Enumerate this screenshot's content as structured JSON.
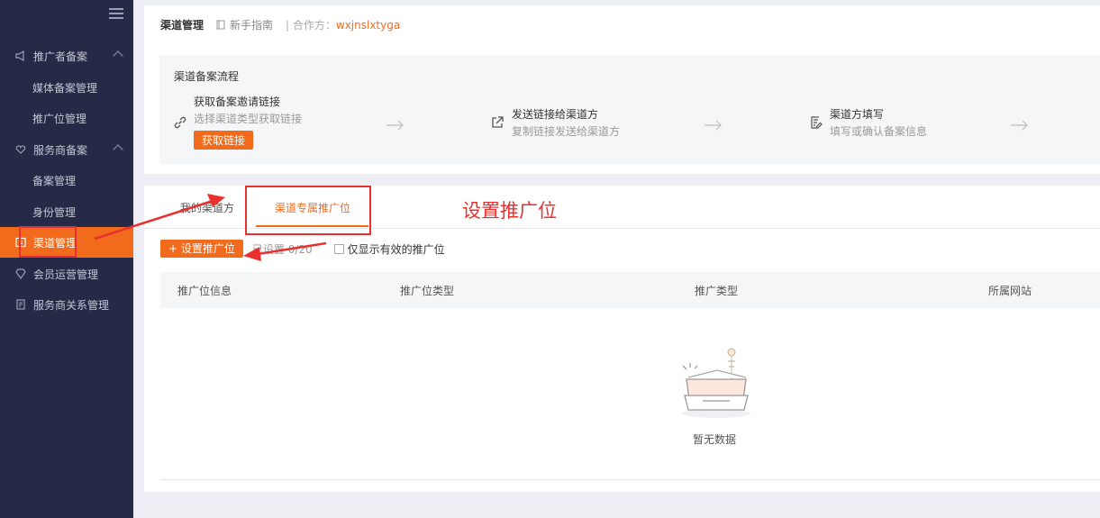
{
  "sidebar": {
    "groups": [
      {
        "label": "推广者备案",
        "icon": "megaphone-icon",
        "items": [
          "媒体备案管理",
          "推广位管理"
        ]
      },
      {
        "label": "服务商备案",
        "icon": "heart-hand-icon",
        "items": [
          "备案管理",
          "身份管理"
        ]
      }
    ],
    "active_item": "渠道管理",
    "items_after": [
      {
        "label": "会员运营管理",
        "icon": "diamond-icon"
      },
      {
        "label": "服务商关系管理",
        "icon": "document-icon"
      }
    ]
  },
  "header": {
    "title": "渠道管理",
    "guide": "新手指南",
    "partner_label": "| 合作方：",
    "partner_value": "wxjnslxtyga"
  },
  "flow": {
    "title": "渠道备案流程",
    "steps": [
      {
        "title": "获取备案邀请链接",
        "desc": "选择渠道类型获取链接",
        "button": "获取链接",
        "icon": "link-icon"
      },
      {
        "title": "发送链接给渠道方",
        "desc": "复制链接发送给渠道方",
        "icon": "share-icon"
      },
      {
        "title": "渠道方填写",
        "desc": "填写或确认备案信息",
        "icon": "form-edit-icon"
      }
    ]
  },
  "tabs": [
    "我的渠道方",
    "渠道专属推广位"
  ],
  "toolbar": {
    "add_button": "+ 设置推广位",
    "count": "已设置 0/20",
    "checkbox_label": "仅显示有效的推广位"
  },
  "table": {
    "columns": [
      "推广位信息",
      "推广位类型",
      "推广类型",
      "所属网站"
    ],
    "rows": [],
    "empty_text": "暂无数据"
  },
  "annotation": {
    "text": "设置推广位",
    "color": "#e8312f"
  },
  "colors": {
    "accent": "#f26b1d",
    "sidebar_bg": "#262a47"
  }
}
